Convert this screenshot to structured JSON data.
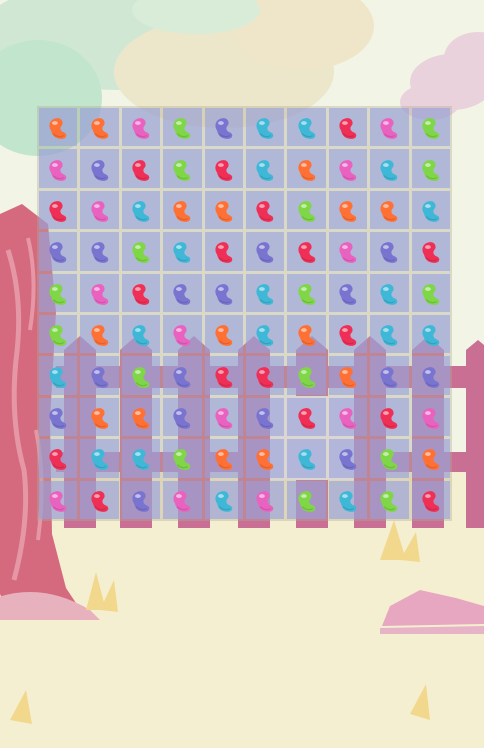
{
  "colors": {
    "orange": "#ff7034",
    "pink": "#ea62c0",
    "green": "#7fd646",
    "purple": "#7a74d1",
    "blue": "#3fb8d7",
    "red": "#ef2f55"
  },
  "board": {
    "rows": [
      [
        "orange",
        "orange",
        "pink",
        "green",
        "purple",
        "blue",
        "blue",
        "red",
        "pink",
        "green"
      ],
      [
        "pink",
        "purple",
        "red",
        "green",
        "red",
        "blue",
        "orange",
        "pink",
        "blue",
        "green"
      ],
      [
        "red",
        "pink",
        "blue",
        "orange",
        "orange",
        "red",
        "green",
        "orange",
        "orange",
        "blue"
      ],
      [
        "purple",
        "purple",
        "green",
        "blue",
        "red",
        "purple",
        "red",
        "pink",
        "purple",
        "red"
      ],
      [
        "green",
        "pink",
        "red",
        "purple",
        "purple",
        "blue",
        "green",
        "purple",
        "blue",
        "green"
      ],
      [
        "green",
        "orange",
        "blue",
        "pink",
        "orange",
        "blue",
        "orange",
        "red",
        "blue",
        "blue"
      ],
      [
        "blue",
        "purple",
        "green",
        "purple",
        "red",
        "red",
        "green",
        "orange",
        "purple",
        "purple"
      ],
      [
        "purple",
        "orange",
        "orange",
        "purple",
        "pink",
        "purple",
        "red",
        "pink",
        "red",
        "pink"
      ],
      [
        "red",
        "blue",
        "blue",
        "green",
        "orange",
        "orange",
        "blue",
        "purple",
        "green",
        "orange"
      ],
      [
        "pink",
        "red",
        "purple",
        "pink",
        "blue",
        "pink",
        "green",
        "blue",
        "green",
        "red"
      ]
    ]
  }
}
